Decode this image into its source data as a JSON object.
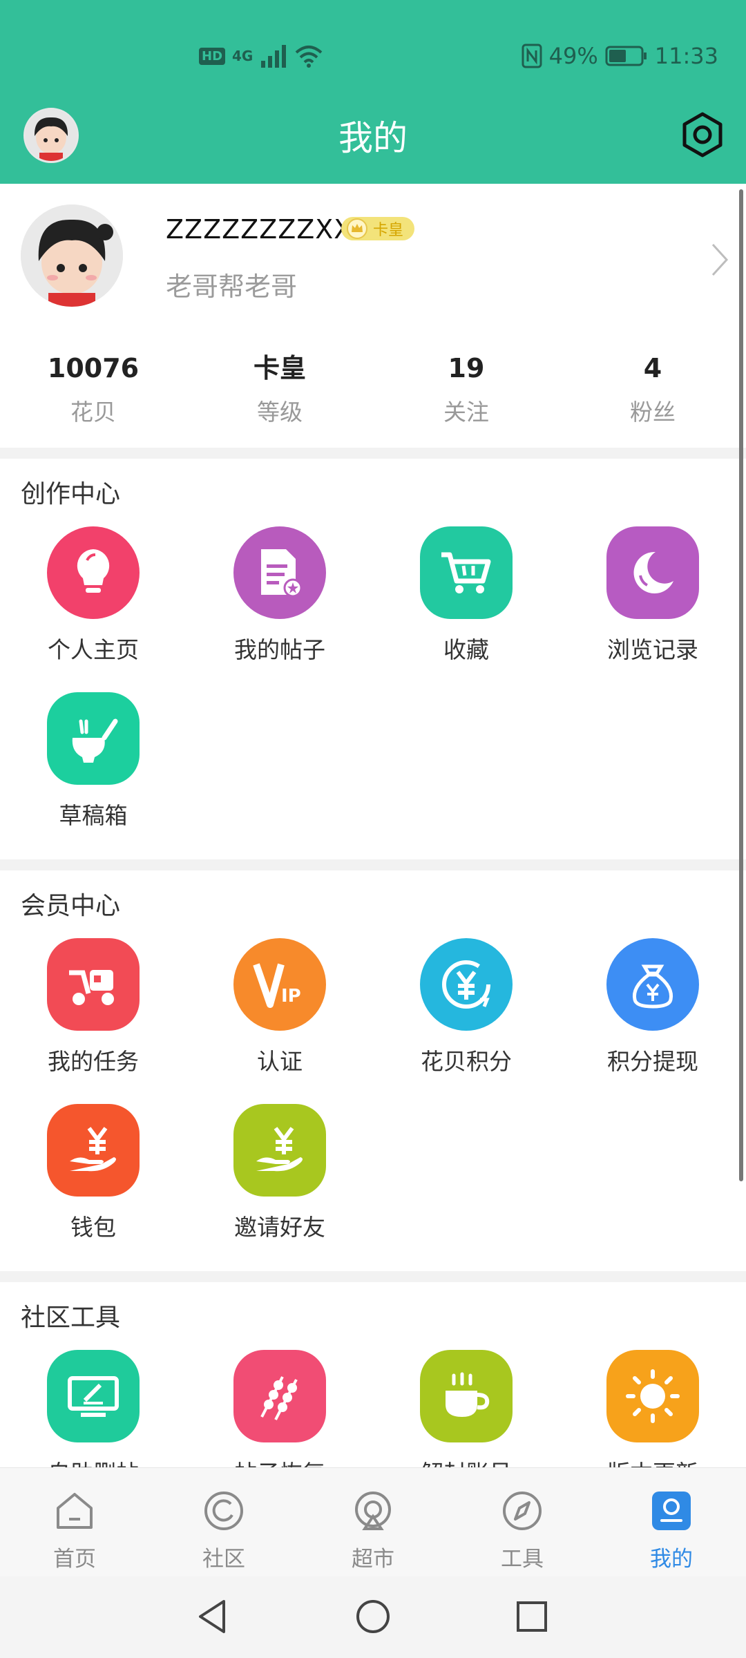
{
  "status_bar": {
    "hd": "HD",
    "net": "4G",
    "battery": "49%",
    "time": "11:33"
  },
  "header": {
    "title": "我的"
  },
  "profile": {
    "username": "ZZZZZZZZXX",
    "badge": "卡皇",
    "signature": "老哥帮老哥",
    "stats": [
      {
        "value": "10076",
        "label": "花贝"
      },
      {
        "value": "卡皇",
        "label": "等级"
      },
      {
        "value": "19",
        "label": "关注"
      },
      {
        "value": "4",
        "label": "粉丝"
      }
    ]
  },
  "creation": {
    "title": "创作中心",
    "items": [
      {
        "label": "个人主页",
        "color": "#f2416b"
      },
      {
        "label": "我的帖子",
        "color": "#b85bbd"
      },
      {
        "label": "收藏",
        "color": "#22c9a0"
      },
      {
        "label": "浏览记录",
        "color": "#b75bc2"
      },
      {
        "label": "草稿箱",
        "color": "#1ccf9e"
      }
    ]
  },
  "member": {
    "title": "会员中心",
    "items": [
      {
        "label": "我的任务",
        "color": "#f24b55"
      },
      {
        "label": "认证",
        "color": "#f78a2b"
      },
      {
        "label": "花贝积分",
        "color": "#25b7de"
      },
      {
        "label": "积分提现",
        "color": "#3d8ef4"
      },
      {
        "label": "钱包",
        "color": "#f5562d"
      },
      {
        "label": "邀请好友",
        "color": "#a8c71f"
      }
    ]
  },
  "tools": {
    "title": "社区工具",
    "items": [
      {
        "label": "自助删帖",
        "color": "#1fcb9b"
      },
      {
        "label": "帖子恢复",
        "color": "#f14d74"
      },
      {
        "label": "解封账号",
        "color": "#a8c71f"
      },
      {
        "label": "版本更新",
        "color": "#f7a21b"
      }
    ]
  },
  "tabbar": [
    {
      "label": "首页"
    },
    {
      "label": "社区"
    },
    {
      "label": "超市"
    },
    {
      "label": "工具"
    },
    {
      "label": "我的"
    }
  ]
}
